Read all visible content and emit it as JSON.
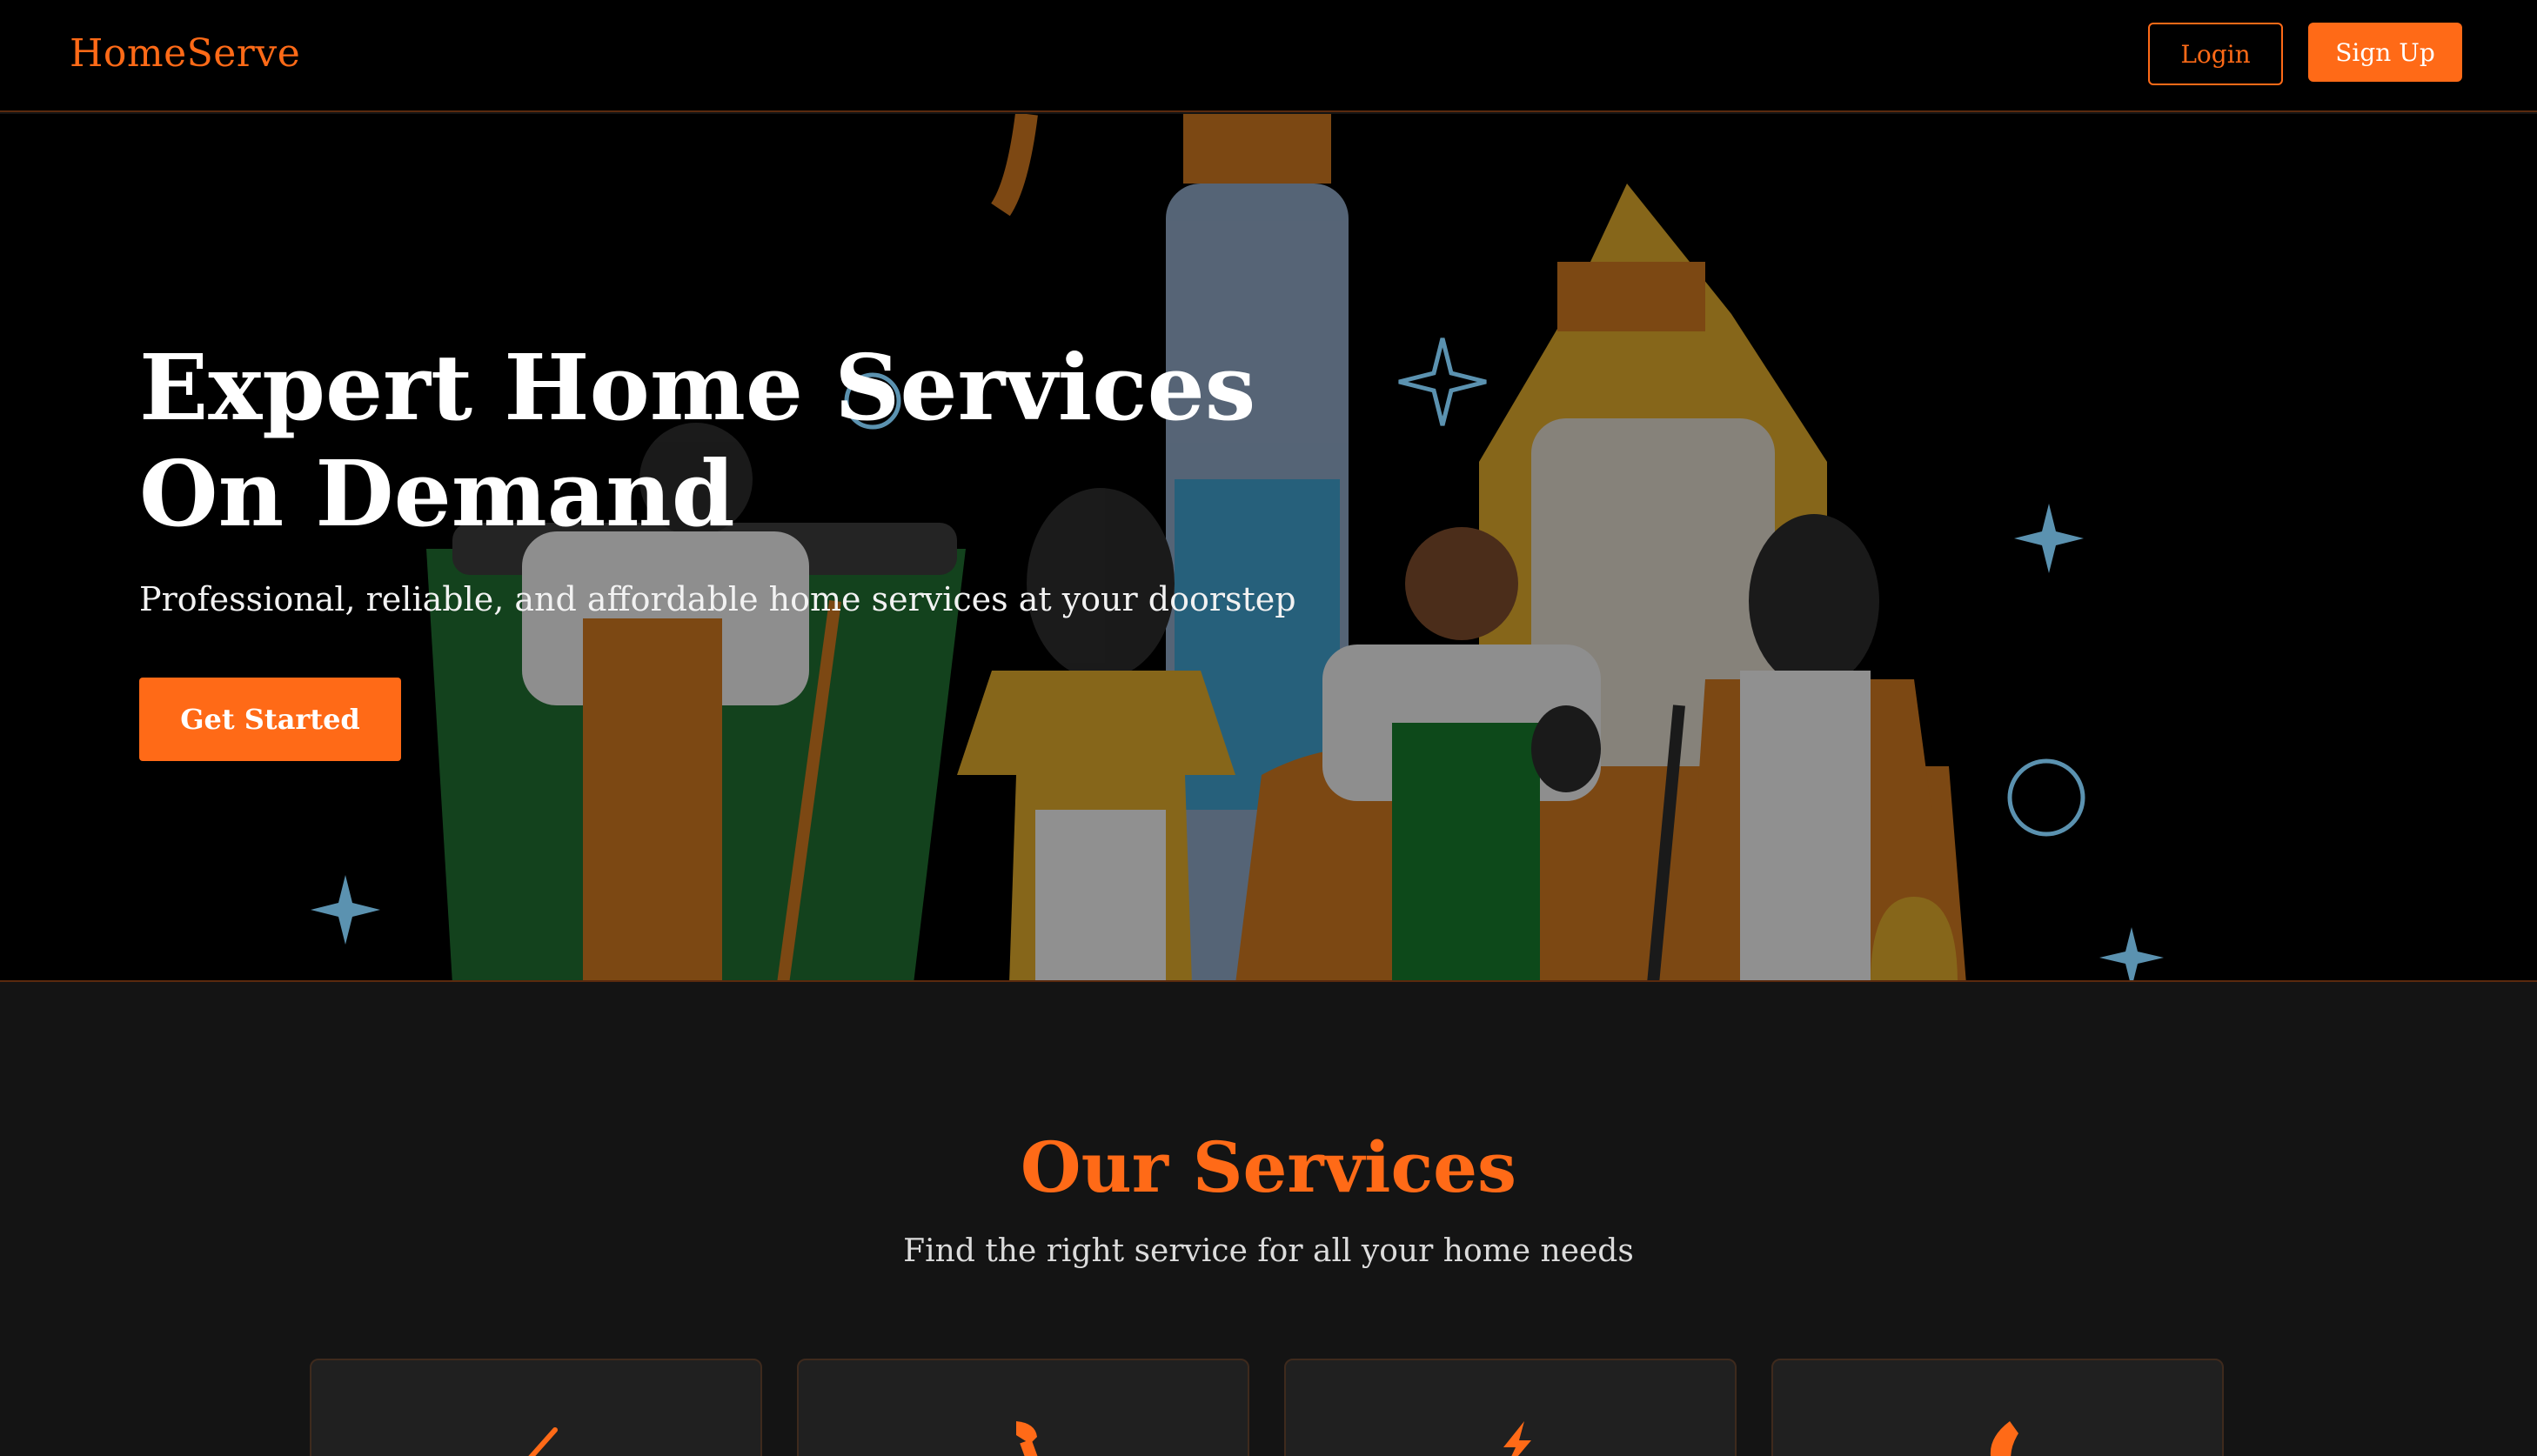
{
  "nav": {
    "logo": "HomeServe",
    "login_label": "Login",
    "signup_label": "Sign Up"
  },
  "hero": {
    "title": "Expert Home Services On Demand",
    "subtitle": "Professional, reliable, and affordable home services at your doorstep",
    "cta_label": "Get Started"
  },
  "services": {
    "title": "Our Services",
    "subtitle": "Find the right service for all your home needs",
    "cards": [
      {
        "icon": "paintbrush-icon"
      },
      {
        "icon": "wrench-icon"
      },
      {
        "icon": "bolt-icon"
      },
      {
        "icon": "flame-icon"
      }
    ]
  },
  "colors": {
    "accent": "#ff6a17",
    "nav_bg": "#000000",
    "section_bg": "#141414",
    "card_bg": "#202020"
  }
}
